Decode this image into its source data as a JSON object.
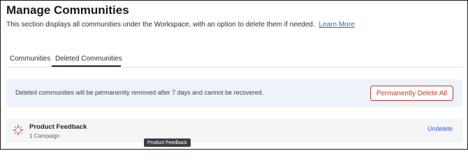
{
  "header": {
    "title": "Manage Communities",
    "description": "This section displays all communities under the Workspace, with an option to delete them if needed.",
    "learn_more": "Learn More"
  },
  "tabs": [
    {
      "label": "Communities",
      "active": false
    },
    {
      "label": "Deleted Communities",
      "active": true
    }
  ],
  "notice": {
    "text": "Deleted communities will be permanently removed after 7 days and cannot be recovered.",
    "button_label": "Permanently Delete All"
  },
  "deleted_items": [
    {
      "icon": "loading-spinner-icon",
      "name": "Product Feedback",
      "meta": "1 Campaign",
      "action_label": "Undelete"
    }
  ],
  "tooltip": {
    "text": "Product Feedback"
  },
  "colors": {
    "danger": "#c0392b",
    "link": "#3b5bdb",
    "notice_bg": "#eef3f9",
    "row_bg": "#f4f5f7"
  }
}
